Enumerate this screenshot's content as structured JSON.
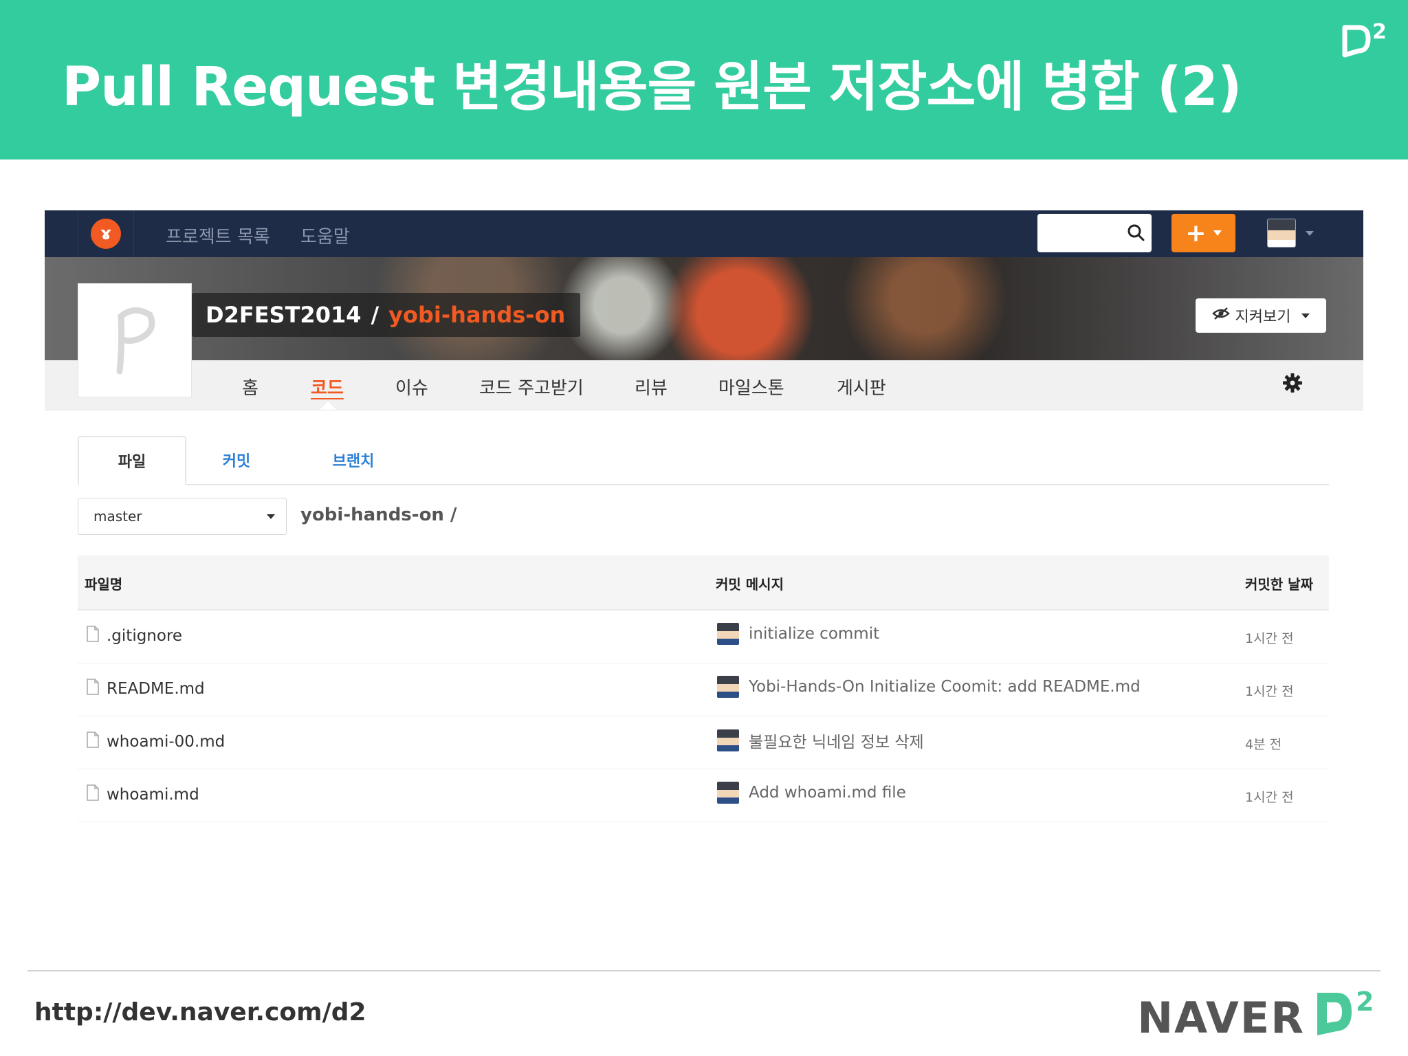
{
  "slide": {
    "title": "Pull Request 변경내용을 원본 저장소에 병합 (2)",
    "footer_url": "http://dev.naver.com/d2",
    "footer_brand": "NAVER",
    "accent_color": "#33cc9e"
  },
  "app": {
    "brand_icon": "yobi-logo-icon",
    "nav": {
      "projects": "프로젝트 목록",
      "help": "도움말"
    },
    "search": {
      "value": "",
      "placeholder": ""
    },
    "plus_label": "+",
    "project": {
      "owner": "D2FEST2014",
      "separator": "/",
      "name": "yobi-hands-on"
    },
    "watch_label": "지켜보기",
    "tabs": [
      {
        "label": "홈"
      },
      {
        "label": "코드",
        "active": true
      },
      {
        "label": "이슈"
      },
      {
        "label": "코드 주고받기"
      },
      {
        "label": "리뷰"
      },
      {
        "label": "마일스톤"
      },
      {
        "label": "게시판"
      }
    ],
    "subtabs": [
      {
        "label": "파일",
        "active": true
      },
      {
        "label": "커밋"
      },
      {
        "label": "브랜치"
      }
    ],
    "branch": "master",
    "path": "yobi-hands-on /",
    "table": {
      "headers": {
        "name": "파일명",
        "message": "커밋 메시지",
        "date": "커밋한 날짜"
      },
      "rows": [
        {
          "name": ".gitignore",
          "message": "initialize commit",
          "date": "1시간 전"
        },
        {
          "name": "README.md",
          "message": "Yobi-Hands-On Initialize Coomit: add README.md",
          "date": "1시간 전"
        },
        {
          "name": "whoami-00.md",
          "message": "불필요한 닉네임 정보 삭제",
          "date": "4분 전"
        },
        {
          "name": "whoami.md",
          "message": "Add whoami.md file",
          "date": "1시간 전"
        }
      ]
    },
    "colors": {
      "topnav": "#1e2c47",
      "orange": "#f7831b",
      "brand_red": "#f15a22",
      "link_blue": "#2b7fd6"
    }
  }
}
